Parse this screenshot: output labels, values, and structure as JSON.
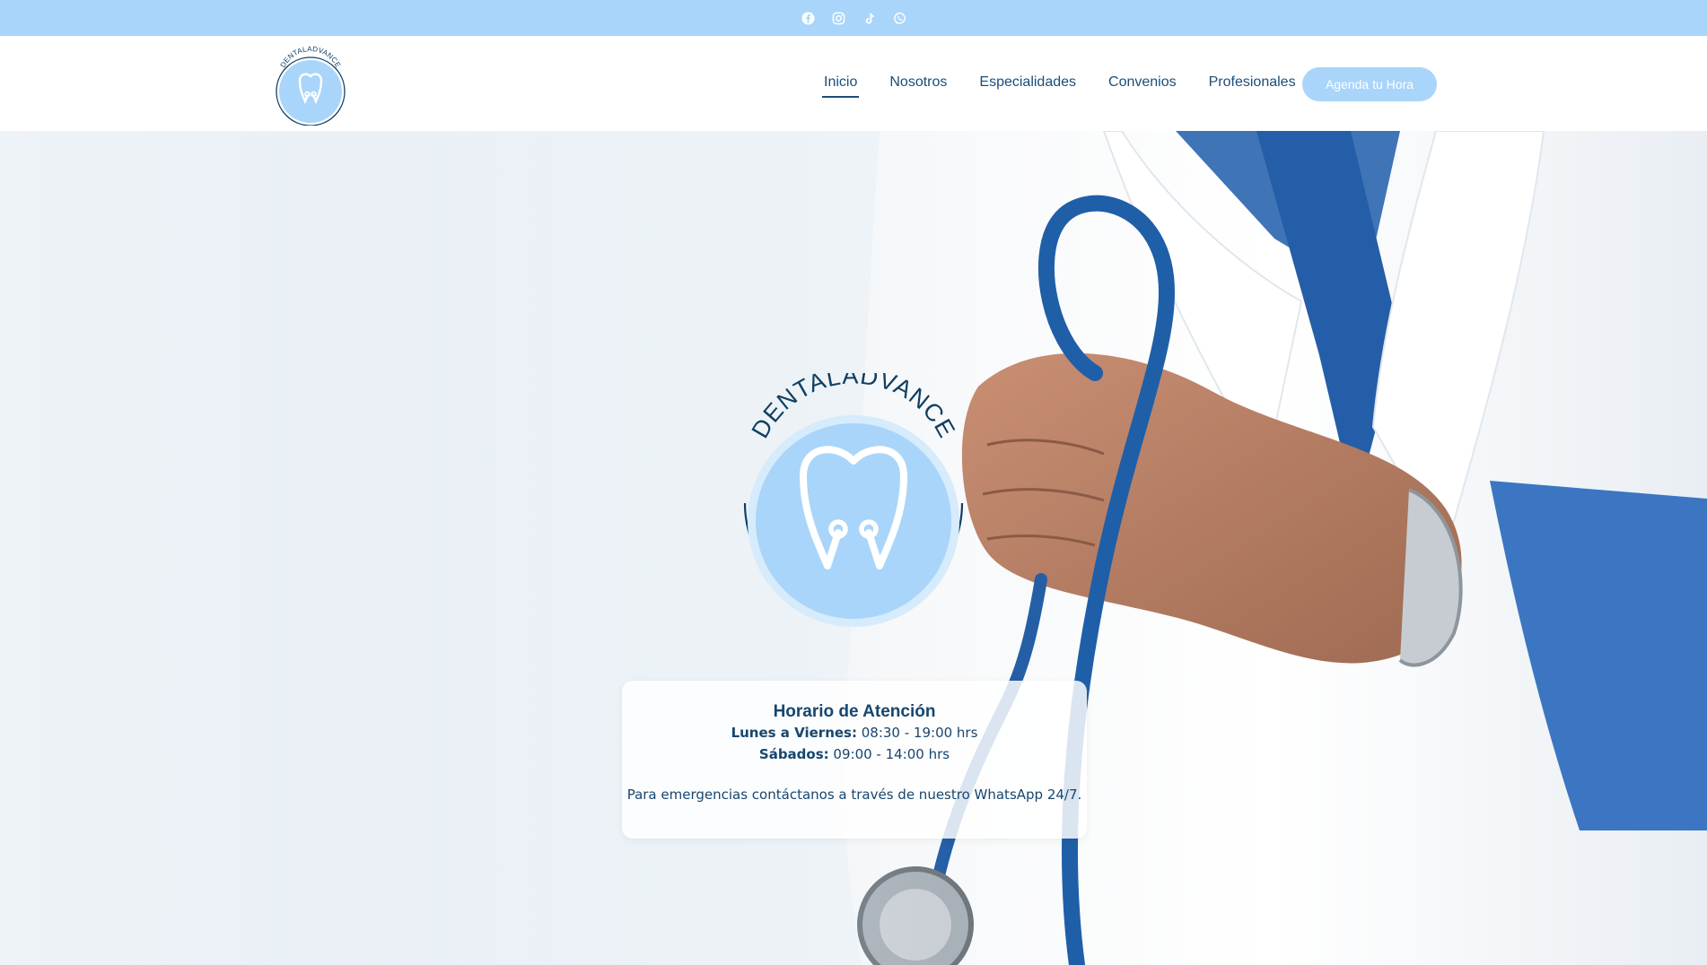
{
  "topbar": {
    "icons": [
      "facebook-icon",
      "instagram-icon",
      "tiktok-icon",
      "whatsapp-icon"
    ]
  },
  "header": {
    "logo_text": "DENTALADVANCE",
    "nav": [
      {
        "label": "Inicio",
        "active": true
      },
      {
        "label": "Nosotros"
      },
      {
        "label": "Especialidades"
      },
      {
        "label": "Convenios"
      },
      {
        "label": "Profesionales"
      }
    ],
    "cta_label": "Agenda tu Hora"
  },
  "hero": {
    "logo_text": "DENTALADVANCE",
    "hours": {
      "title": "Horario de Atención",
      "weekday_label": "Lunes a Viernes:",
      "weekday_value": " 08:30 - 19:00 hrs",
      "saturday_label": "Sábados:",
      "saturday_value": " 09:00 - 14:00 hrs",
      "note": "Para emergencias contáctanos a través de nuestro WhatsApp 24/7."
    }
  },
  "colors": {
    "accent": "#a9d5fa",
    "text": "#17466f",
    "logo_ring": "#0f3f63"
  }
}
